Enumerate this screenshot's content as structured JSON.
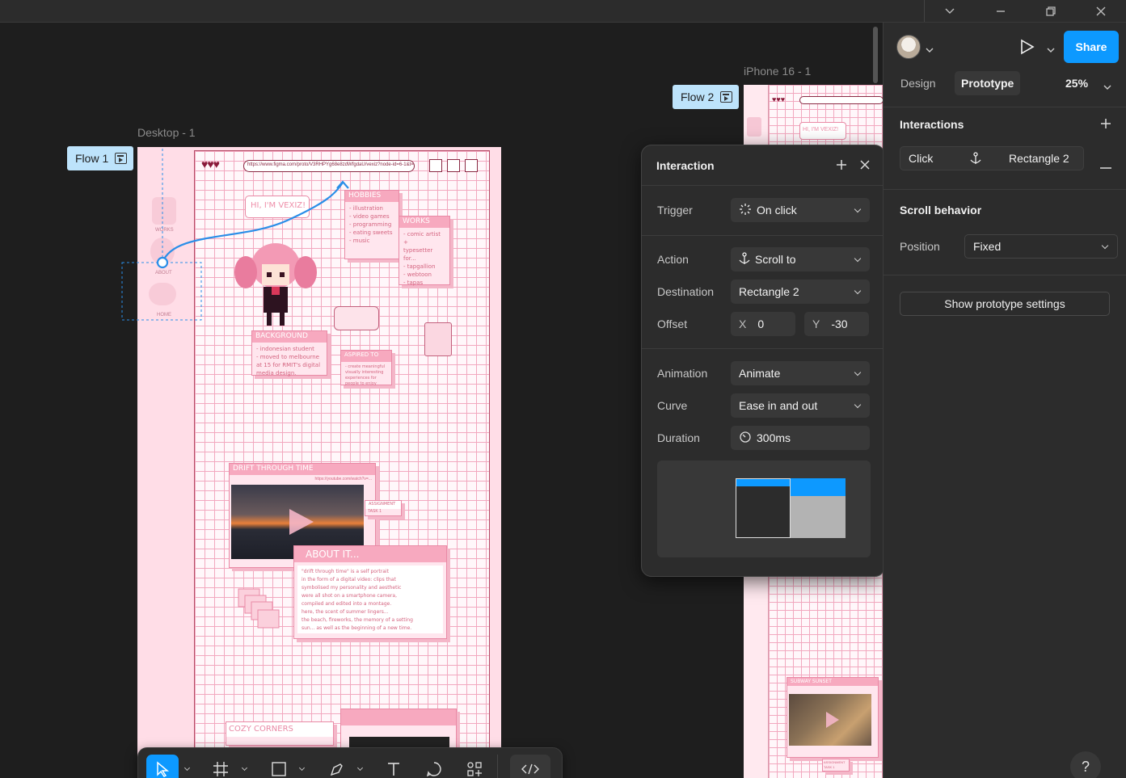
{
  "canvas": {
    "frames": [
      {
        "label": "Desktop - 1",
        "flow": "Flow 1"
      },
      {
        "label": "iPhone 16 - 1",
        "flow": "Flow 2"
      }
    ],
    "desktop_page": {
      "url": "https://www.figma.com/proto/V3RHPYg68e8zdWfgdaU/vexiz?node-id=6-1&t=n2...",
      "hero_text": "HI, I'M VEXIZ!",
      "side_labels": [
        "WORKS",
        "ABOUT",
        "HOME"
      ],
      "windows": {
        "hobbies": {
          "title": "HOBBIES",
          "lines": [
            "- illustration",
            "- video games",
            "- programming",
            "- eating sweets",
            "- music"
          ]
        },
        "works": {
          "title": "WORKS",
          "lines": [
            "- comic artist +",
            "typesetter for...",
            "- tapgallion",
            "- webtoon",
            "- tapas"
          ]
        },
        "background": {
          "title": "BACKGROUND",
          "lines": [
            "- indonesian student",
            "- moved to melbourne",
            "at 15 for RMIT's digital",
            "media design."
          ]
        },
        "aspired": {
          "title": "ASPIRED TO",
          "lines": [
            "- create meaningful",
            "visually interesting",
            "experiences for",
            "people to enjoy"
          ]
        },
        "drift": {
          "title": "DRIFT THROUGH TIME",
          "url": "https://youtube.com/watch?v=..."
        },
        "about": {
          "title": "ABOUT IT...",
          "lines": [
            "\"drift through time\" is a self portrait",
            "in the form of a digital video: clips that",
            "symbolised my personality and aesthetic",
            "were all shot on a smartphone camera,",
            "compiled and edited into a montage.",
            "here, the scent of summer lingers...",
            "the beach, fireworks, the memory of a setting",
            "sun... as well as the beginning of a new time."
          ]
        },
        "assignment": {
          "title": "ASSIGNMENT",
          "subtitle": "TASK 1"
        },
        "cozy": {
          "title": "COZY CORNERS"
        }
      }
    },
    "iphone_page": {
      "hero_text": "HI, I'M VEXIZ!",
      "subway": {
        "title": "SUBWAY SUNSET"
      },
      "assignment": {
        "title": "ASSIGNMENT",
        "subtitle": "TASK 1"
      }
    }
  },
  "popover": {
    "title": "Interaction",
    "rows": {
      "trigger": {
        "label": "Trigger",
        "value": "On click"
      },
      "action": {
        "label": "Action",
        "value": "Scroll to"
      },
      "destination": {
        "label": "Destination",
        "value": "Rectangle 2"
      },
      "offset": {
        "label": "Offset",
        "x_label": "X",
        "x": "0",
        "y_label": "Y",
        "y": "-30"
      },
      "animation": {
        "label": "Animation",
        "value": "Animate"
      },
      "curve": {
        "label": "Curve",
        "value": "Ease in and out"
      },
      "duration": {
        "label": "Duration",
        "value": "300ms"
      }
    }
  },
  "right_panel": {
    "share": "Share",
    "tabs": [
      "Design",
      "Prototype"
    ],
    "zoom": "25%",
    "interactions": {
      "heading": "Interactions",
      "item": {
        "trigger": "Click",
        "target": "Rectangle 2"
      }
    },
    "scroll_behavior": {
      "heading": "Scroll behavior",
      "position_label": "Position",
      "position_value": "Fixed"
    },
    "prototype_settings": "Show prototype settings",
    "help": "?"
  },
  "colors": {
    "accent": "#0d99ff",
    "flow_badge": "#bde3fb",
    "page_pink": "#ffdde7"
  }
}
